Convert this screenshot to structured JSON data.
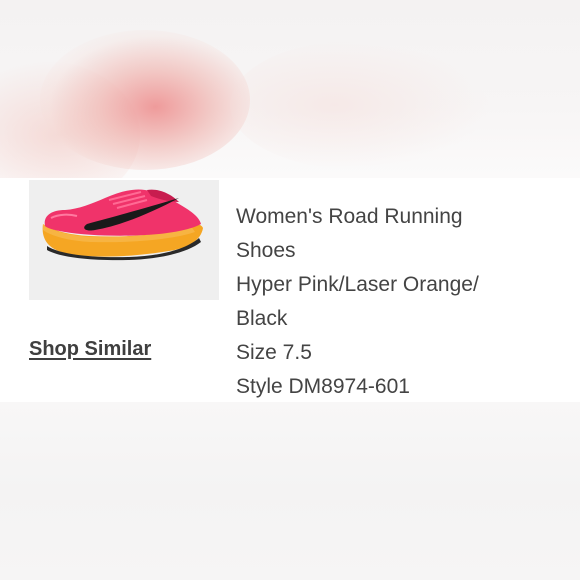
{
  "product": {
    "title_line1": "Women's Road Running",
    "title_line2": "Shoes",
    "color_line1": "Hyper Pink/Laser Orange/",
    "color_line2": "Black",
    "size": "Size 7.5",
    "style": "Style DM8974-601"
  },
  "actions": {
    "shop_similar": "Shop Similar"
  },
  "colors": {
    "upper_pink": "#f0336a",
    "sole_orange": "#f5a623",
    "swoosh": "#1a1a1a",
    "thumb_bg": "#efefef"
  }
}
